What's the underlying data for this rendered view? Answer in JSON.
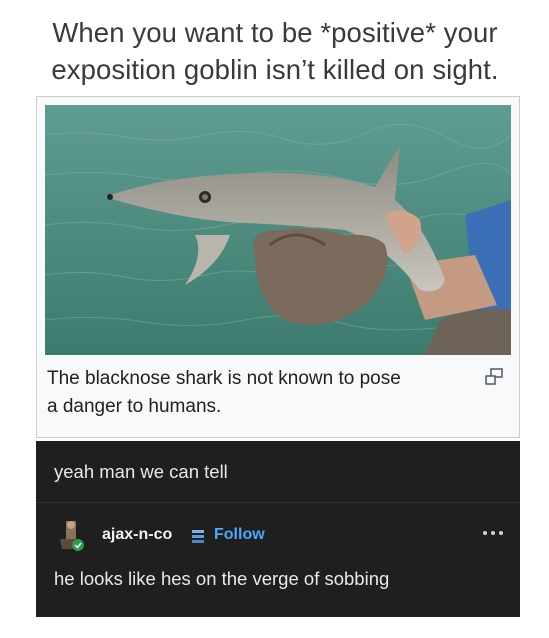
{
  "caption": {
    "line1": "When you want to be *positive* your",
    "line2": "exposition goblin isn’t killed on sight."
  },
  "wiki": {
    "image_subject": "shark-held-over-water",
    "caption_line1": "The blacknose shark is not known to pose",
    "caption_line2": "a danger to humans.",
    "enlarge_icon": "enlarge-icon"
  },
  "tumblr": {
    "reply_top": "yeah man we can tell",
    "username": "ajax-n-co",
    "follow_label": "Follow",
    "reply_bottom": "he looks like hes on the verge of sobbing",
    "colors": {
      "background": "#1f1f1f",
      "follow": "#4aa8ff",
      "text": "#e9e9e9"
    }
  }
}
